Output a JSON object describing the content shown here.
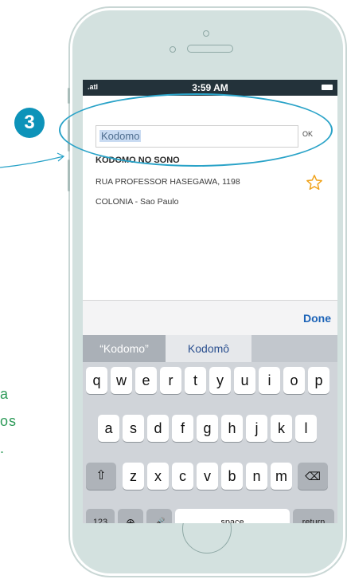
{
  "annotation": {
    "step_number": "3"
  },
  "side_text": [
    "a",
    "os",
    "."
  ],
  "status_bar": {
    "signal": ".atl",
    "time": "3:59 AM"
  },
  "search": {
    "value": "Kodomo",
    "ok_label": "OK"
  },
  "result": {
    "name": "KODOMO NO SONO",
    "address": "RUA PROFESSOR HASEGAWA, 1198",
    "city": "COLONIA - Sao Paulo"
  },
  "done_label": "Done",
  "suggestions": [
    "“Kodomo”",
    "Kodomô"
  ],
  "keyboard": {
    "row1": [
      "q",
      "w",
      "e",
      "r",
      "t",
      "y",
      "u",
      "i",
      "o",
      "p"
    ],
    "row2": [
      "a",
      "s",
      "d",
      "f",
      "g",
      "h",
      "j",
      "k",
      "l"
    ],
    "row3": [
      "z",
      "x",
      "c",
      "v",
      "b",
      "n",
      "m"
    ],
    "row4": {
      "numbers": "123",
      "globe": "⊕",
      "mic": "🎤",
      "space": "space",
      "return": "return"
    }
  },
  "colors": {
    "accent": "#0d93b9",
    "green_text": "#2d9a58",
    "phone_body": "#d3e1df",
    "done_blue": "#1c63b7"
  }
}
